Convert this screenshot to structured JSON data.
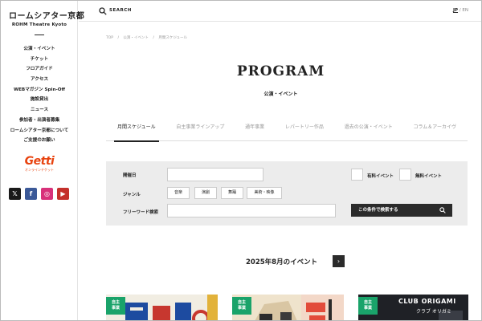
{
  "sidebar": {
    "logo_jp": "ロームシアター京都",
    "logo_en": "ROHM Theatre Kyoto",
    "nav": [
      "公演・イベント",
      "チケット",
      "フロアガイド",
      "アクセス",
      "WEBマガジン Spin-Off",
      "施設貸出",
      "ニュース",
      "参加者・出演者募集",
      "ロームシアター京都について",
      "ご支援のお願い"
    ],
    "getti_logo": "Getti",
    "getti_sub": "オンラインチケット",
    "social": [
      {
        "icon": "x-icon",
        "glyph": "𝕏"
      },
      {
        "icon": "facebook-icon",
        "glyph": "f"
      },
      {
        "icon": "instagram-icon",
        "glyph": "◎"
      },
      {
        "icon": "youtube-icon",
        "glyph": "▶"
      }
    ]
  },
  "topbar": {
    "search_label": "SEARCH",
    "lang_jp": "JP",
    "lang_sep": "/",
    "lang_en": "EN"
  },
  "breadcrumb": [
    "TOP",
    "/",
    "公演・イベント",
    "/",
    "月間スケジュール"
  ],
  "page": {
    "title": "PROGRAM",
    "subtitle": "公演・イベント"
  },
  "tabs": [
    {
      "label": "月間スケジュール",
      "active": true
    },
    {
      "label": "自主事業ラインアップ",
      "active": false
    },
    {
      "label": "通年事業",
      "active": false
    },
    {
      "label": "レパートリー作品",
      "active": false
    },
    {
      "label": "過去の公演・イベント",
      "active": false
    },
    {
      "label": "コラム＆アーカイヴ",
      "active": false
    }
  ],
  "filter": {
    "date_label": "開催日",
    "paid_label": "有料イベント",
    "free_label": "無料イベント",
    "genre_label": "ジャンル",
    "genres": [
      "音楽",
      "演劇",
      "舞踊",
      "美術・映像"
    ],
    "keyword_label": "フリーワード検索",
    "search_button": "この条件で検索する"
  },
  "schedule": {
    "month_heading": "2025年8月のイベント",
    "next_glyph": "›"
  },
  "cards": [
    {
      "badge": "自主\n事業"
    },
    {
      "badge": "自主\n事業"
    },
    {
      "badge": "自主\n事業",
      "title": "CLUB ORIGAMI",
      "title_jp": "クラブ オリガミ"
    }
  ],
  "colors": {
    "accent_green": "#1aa36a",
    "getti_orange": "#e8430f",
    "dark_button": "#2b2b2b",
    "filter_bg": "#ececec"
  }
}
